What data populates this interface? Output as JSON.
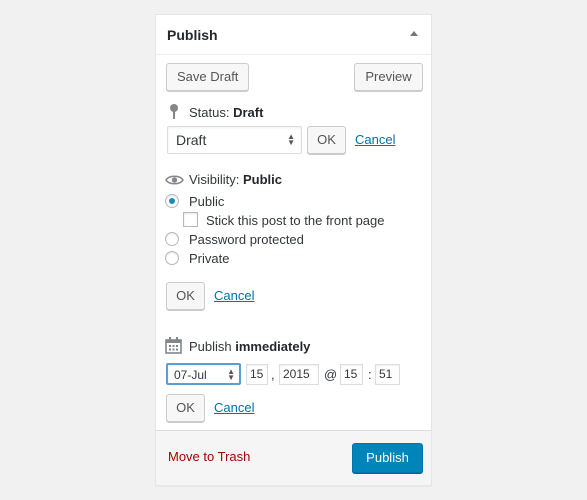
{
  "header": {
    "title": "Publish"
  },
  "actions": {
    "save_draft": "Save Draft",
    "preview": "Preview"
  },
  "status": {
    "label": "Status:",
    "value": "Draft",
    "selected": "Draft",
    "ok": "OK",
    "cancel": "Cancel"
  },
  "visibility": {
    "label": "Visibility:",
    "value": "Public",
    "options": [
      "Public",
      "Password protected",
      "Private"
    ],
    "selected": "Public",
    "sticky_label": "Stick this post to the front page",
    "ok": "OK",
    "cancel": "Cancel"
  },
  "schedule": {
    "label": "Publish",
    "value": "immediately",
    "month": "07-Jul",
    "day": "15",
    "sep1": ",",
    "year": "2015",
    "at": "@",
    "hour": "15",
    "sep2": ":",
    "minute": "51",
    "ok": "OK",
    "cancel": "Cancel"
  },
  "footer": {
    "trash": "Move to Trash",
    "publish": "Publish"
  },
  "colors": {
    "accent": "#0085ba",
    "link": "#0073aa",
    "trash": "#aa0000"
  }
}
